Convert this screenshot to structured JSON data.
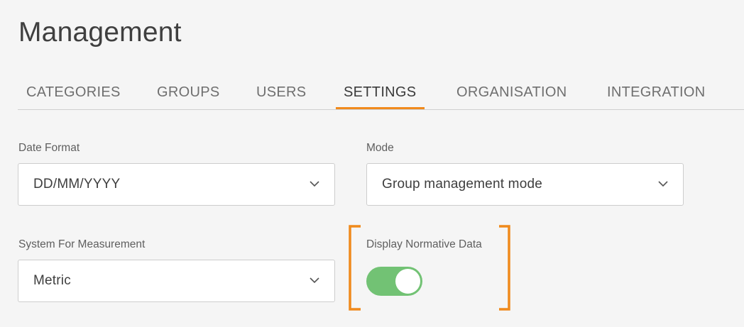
{
  "page": {
    "title": "Management"
  },
  "tabs": [
    {
      "label": "CATEGORIES",
      "active": false
    },
    {
      "label": "GROUPS",
      "active": false
    },
    {
      "label": "USERS",
      "active": false
    },
    {
      "label": "SETTINGS",
      "active": true
    },
    {
      "label": "ORGANISATION",
      "active": false
    },
    {
      "label": "INTEGRATION",
      "active": false
    }
  ],
  "settings": {
    "date_format": {
      "label": "Date Format",
      "value": "DD/MM/YYYY",
      "icon": "chevron-down-icon"
    },
    "mode": {
      "label": "Mode",
      "value": "Group management mode",
      "icon": "chevron-down-icon"
    },
    "measurement": {
      "label": "System For Measurement",
      "value": "Metric",
      "icon": "chevron-down-icon"
    },
    "normative": {
      "label": "Display Normative Data",
      "enabled": true
    }
  },
  "colors": {
    "accent": "#f08a1c",
    "toggle_on": "#72c274",
    "background": "#f5f5f5"
  }
}
